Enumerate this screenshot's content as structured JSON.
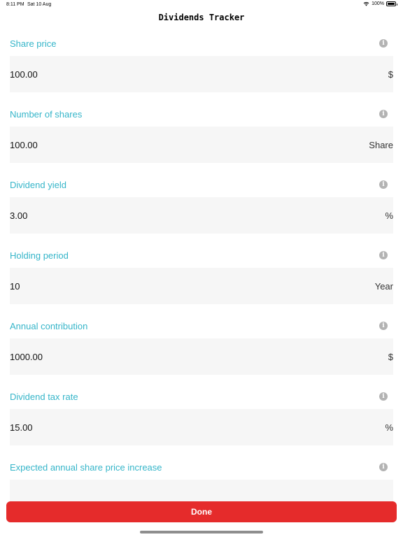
{
  "status": {
    "time": "8:11 PM",
    "date": "Sat 10 Aug",
    "battery": "100%"
  },
  "nav": {
    "title": "Dividends Tracker"
  },
  "fields": [
    {
      "label": "Share price",
      "value": "100.00",
      "unit": "$"
    },
    {
      "label": "Number of shares",
      "value": "100.00",
      "unit": "Share"
    },
    {
      "label": "Dividend yield",
      "value": "3.00",
      "unit": "%"
    },
    {
      "label": "Holding period",
      "value": "10",
      "unit": "Year"
    },
    {
      "label": "Annual contribution",
      "value": "1000.00",
      "unit": "$"
    },
    {
      "label": "Dividend tax rate",
      "value": "15.00",
      "unit": "%"
    },
    {
      "label": "Expected annual share price increase",
      "value": "",
      "unit": ""
    }
  ],
  "info_glyph": "i",
  "done_label": "Done",
  "colors": {
    "label": "#35b5c9",
    "done": "#e52b2b"
  }
}
